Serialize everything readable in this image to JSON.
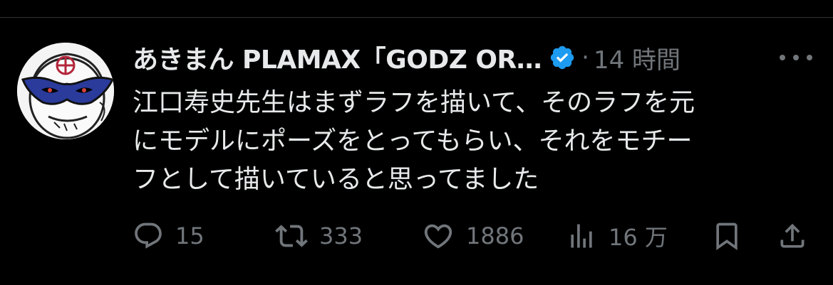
{
  "tweet": {
    "display_name": "あきまん PLAMAX「GODZ OR…",
    "separator": "·",
    "time": "14 時間",
    "text_lines": [
      "江口寿史先生はまずラフを描いて、そのラフを元",
      "にモデルにポーズをとってもらい、それをモチー",
      "フとして描いていると思ってました"
    ]
  },
  "actions": {
    "reply_count": "15",
    "retweet_count": "333",
    "like_count": "1886",
    "view_count": "16 万"
  },
  "icons": {
    "verified": "verified-badge-icon",
    "more": "more-icon",
    "reply": "reply-icon",
    "retweet": "retweet-icon",
    "like": "heart-icon",
    "views": "views-icon",
    "bookmark": "bookmark-icon",
    "share": "share-icon"
  },
  "colors": {
    "background": "#000000",
    "text": "#e7e9ea",
    "secondary": "#71767b",
    "verified": "#1d9bf0",
    "divider": "#2f3336"
  }
}
